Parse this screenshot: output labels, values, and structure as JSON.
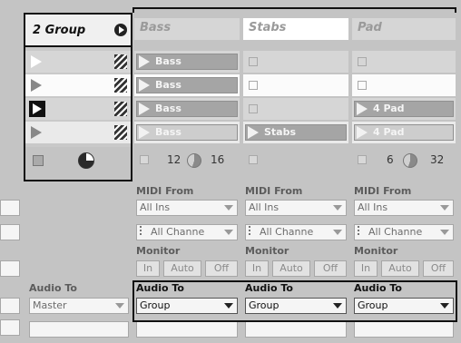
{
  "group_track": {
    "title": "2 Group"
  },
  "tracks": [
    {
      "title": "Bass",
      "clips": [
        "Bass",
        "Bass",
        "Bass",
        "Bass"
      ],
      "stop_value_a": "12",
      "stop_value_b": "16",
      "midi_from_label": "MIDI From",
      "midi_from_value": "All Ins",
      "channel_value": "All Channe",
      "monitor_label": "Monitor",
      "monitor_options": [
        "In",
        "Auto",
        "Off"
      ],
      "audio_to_label": "Audio To",
      "audio_to_value": "Group"
    },
    {
      "title": "Stabs",
      "clips": [
        "",
        "",
        "",
        "Stabs"
      ],
      "midi_from_label": "MIDI From",
      "midi_from_value": "All Ins",
      "channel_value": "All Channe",
      "monitor_label": "Monitor",
      "monitor_options": [
        "In",
        "Auto",
        "Off"
      ],
      "audio_to_label": "Audio To",
      "audio_to_value": "Group"
    },
    {
      "title": "Pad",
      "clips": [
        "",
        "",
        "4 Pad",
        "4 Pad"
      ],
      "stop_value_a": "6",
      "stop_value_b": "32",
      "midi_from_label": "MIDI From",
      "midi_from_value": "All Ins",
      "channel_value": "All Channe",
      "monitor_label": "Monitor",
      "monitor_options": [
        "In",
        "Auto",
        "Off"
      ],
      "audio_to_label": "Audio To",
      "audio_to_value": "Group"
    }
  ],
  "group_io": {
    "audio_to_label": "Audio To",
    "audio_to_value": "Master"
  },
  "colors": {
    "background": "#c4c4c4",
    "clip_fill": "#a5a5a5",
    "highlight_border": "#111111"
  }
}
